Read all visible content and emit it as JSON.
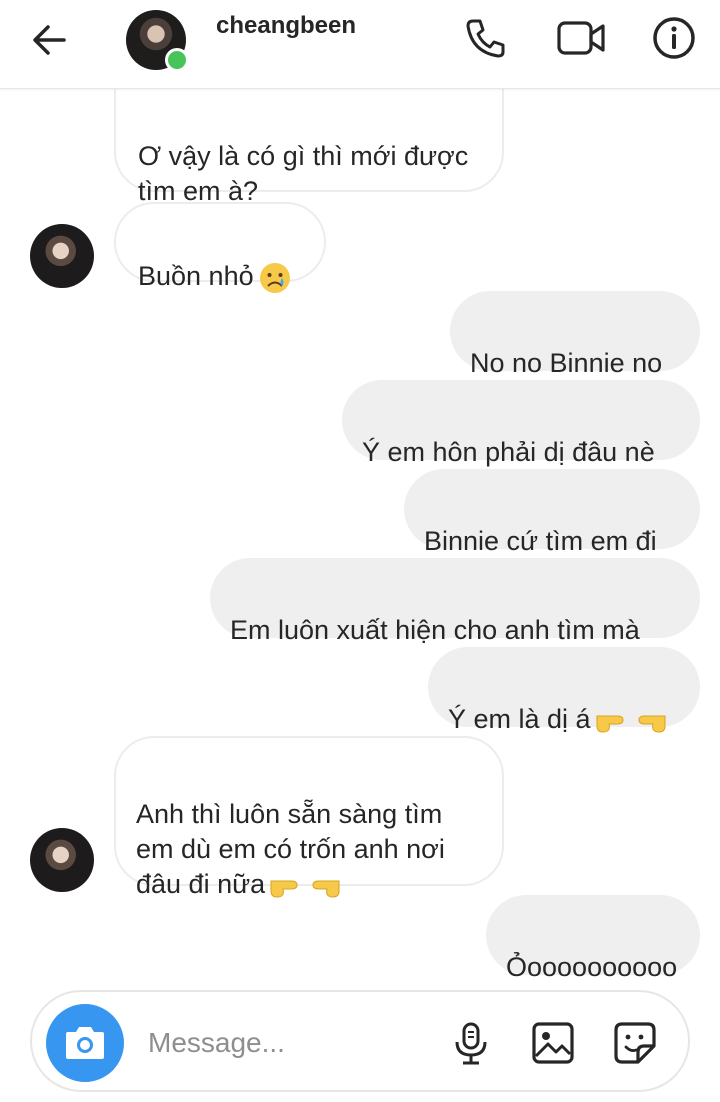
{
  "header": {
    "username": "cheangbeen",
    "online": true
  },
  "messages": [
    {
      "side": "incoming",
      "text": "Ơ vậy là có gì thì mới được\ntìm em à?",
      "emoji": null
    },
    {
      "side": "incoming",
      "text": "Buồn nhỏ",
      "emoji": "sad-face"
    },
    {
      "side": "outgoing",
      "text": "No no Binnie no",
      "emoji": null
    },
    {
      "side": "outgoing",
      "text": "Ý em hôn phải dị đâu nè",
      "emoji": null
    },
    {
      "side": "outgoing",
      "text": "Binnie cứ tìm em đi",
      "emoji": null
    },
    {
      "side": "outgoing",
      "text": "Em luôn xuất hiện cho anh tìm mà",
      "emoji": null
    },
    {
      "side": "outgoing",
      "text": "Ý em là dị á",
      "emoji": "pointing-hands"
    },
    {
      "side": "incoming",
      "text": "Anh thì luôn sẵn sàng tìm\nem dù em có trốn anh nơi\nđâu đi nữa",
      "emoji": "pointing-hands"
    },
    {
      "side": "outgoing",
      "text": "Ỏoooooooooo",
      "emoji": null
    }
  ],
  "composer": {
    "placeholder": "Message..."
  },
  "icons": {
    "back": "arrow-left-icon",
    "call": "phone-icon",
    "video": "video-camera-icon",
    "info": "info-icon",
    "camera": "camera-icon",
    "mic": "microphone-icon",
    "gallery": "image-icon",
    "sticker": "sticker-icon"
  },
  "colors": {
    "accent": "#3797f0",
    "online": "#47c45a",
    "outgoing_bubble": "#efefef"
  }
}
